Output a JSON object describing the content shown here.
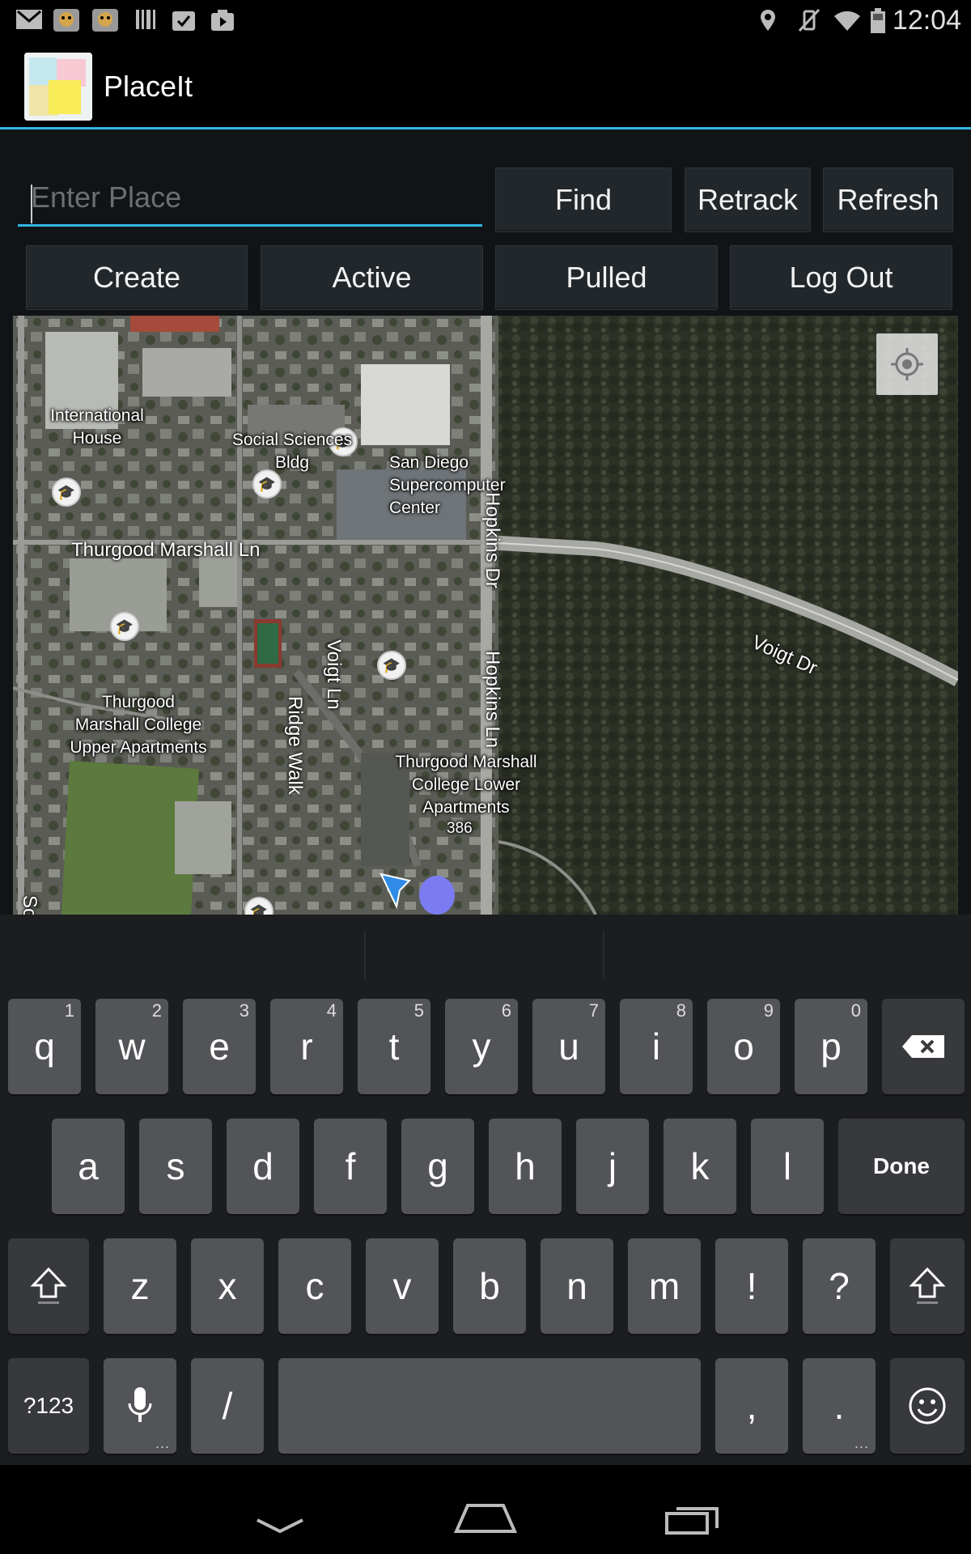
{
  "status_bar": {
    "time": "12:04",
    "left_icons": [
      "gmail-icon",
      "app-icon",
      "app-icon",
      "barcode-icon",
      "clipboard-icon",
      "play-store-icon"
    ],
    "right_icons": [
      "location-icon",
      "vibrate-off-icon",
      "wifi-icon",
      "battery-icon"
    ]
  },
  "action_bar": {
    "title": "PlaceIt",
    "accent": "#33b5e5"
  },
  "search": {
    "placeholder": "Enter Place",
    "value": ""
  },
  "buttons": {
    "find": "Find",
    "retrack": "Retrack",
    "refresh": "Refresh",
    "create": "Create",
    "active": "Active",
    "pulled": "Pulled",
    "logout": "Log Out"
  },
  "map": {
    "labels": {
      "international_house": "International House",
      "social_sciences": "Social Sciences Bldg",
      "sdsc": "San Diego Supercomputer Center",
      "thurgood_ln": "Thurgood Marshall Ln",
      "upper_apts": "Thurgood Marshall College Upper Apartments",
      "lower_apts": "Thurgood Marshall College Lower Apartments",
      "voigt_dr": "Voigt Dr",
      "voigt_ln": "Voigt Ln",
      "ridge_walk": "Ridge Walk",
      "hopkins_dr": "Hopkins Dr",
      "hopkins_ln": "Hopkins Ln",
      "route_num": "386",
      "edge_text": "So"
    },
    "marker_color": "#7b7cf2"
  },
  "keyboard": {
    "row1": [
      {
        "k": "q",
        "h": "1"
      },
      {
        "k": "w",
        "h": "2"
      },
      {
        "k": "e",
        "h": "3"
      },
      {
        "k": "r",
        "h": "4"
      },
      {
        "k": "t",
        "h": "5"
      },
      {
        "k": "y",
        "h": "6"
      },
      {
        "k": "u",
        "h": "7"
      },
      {
        "k": "i",
        "h": "8"
      },
      {
        "k": "o",
        "h": "9"
      },
      {
        "k": "p",
        "h": "0"
      }
    ],
    "row2": [
      "a",
      "s",
      "d",
      "f",
      "g",
      "h",
      "j",
      "k",
      "l"
    ],
    "done": "Done",
    "row3": [
      "z",
      "x",
      "c",
      "v",
      "b",
      "n",
      "m",
      "!",
      "?"
    ],
    "symbols": "?123",
    "slash": "/",
    "comma": ",",
    "period": ".",
    "dots": "..."
  }
}
